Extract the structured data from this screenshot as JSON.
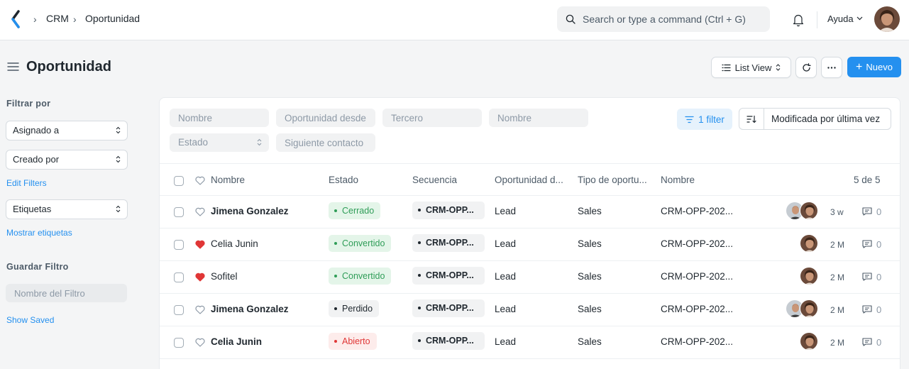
{
  "navbar": {
    "breadcrumbs": [
      "CRM",
      "Oportunidad"
    ],
    "search_placeholder": "Search or type a command (Ctrl + G)",
    "help_label": "Ayuda"
  },
  "header": {
    "title": "Oportunidad",
    "view_label": "List View",
    "new_label": "Nuevo"
  },
  "sidebar": {
    "filter_heading": "Filtrar por",
    "assigned_label": "Asignado a",
    "created_label": "Creado por",
    "edit_filters": "Edit Filters",
    "tags_label": "Etiquetas",
    "show_tags": "Mostrar etiquetas",
    "save_heading": "Guardar Filtro",
    "filter_name_placeholder": "Nombre del Filtro",
    "show_saved": "Show Saved"
  },
  "filters": {
    "nombre_placeholder": "Nombre",
    "desde_placeholder": "Oportunidad desde",
    "tercero_placeholder": "Tercero",
    "nombre2_placeholder": "Nombre",
    "estado_label": "Estado",
    "contacto_placeholder": "Siguiente contacto",
    "filter_count_label": "1 filter",
    "sort_label": "Modificada por última vez"
  },
  "table": {
    "headers": {
      "nombre": "Nombre",
      "estado": "Estado",
      "secuencia": "Secuencia",
      "oportunidad": "Oportunidad d...",
      "tipo": "Tipo de oportu...",
      "nombre2": "Nombre",
      "count": "5 de 5"
    },
    "rows": [
      {
        "name": "Jimena Gonzalez",
        "status": "Cerrado",
        "sequence": "CRM-OPP...",
        "from": "Lead",
        "type": "Sales",
        "ref": "CRM-OPP-202...",
        "time": "3 w",
        "comments": "0"
      },
      {
        "name": "Celia Junin",
        "status": "Convertido",
        "sequence": "CRM-OPP...",
        "from": "Lead",
        "type": "Sales",
        "ref": "CRM-OPP-202...",
        "time": "2 M",
        "comments": "0"
      },
      {
        "name": "Sofitel",
        "status": "Convertido",
        "sequence": "CRM-OPP...",
        "from": "Lead",
        "type": "Sales",
        "ref": "CRM-OPP-202...",
        "time": "2 M",
        "comments": "0"
      },
      {
        "name": "Jimena Gonzalez",
        "status": "Perdido",
        "sequence": "CRM-OPP...",
        "from": "Lead",
        "type": "Sales",
        "ref": "CRM-OPP-202...",
        "time": "2 M",
        "comments": "0"
      },
      {
        "name": "Celia Junin",
        "status": "Abierto",
        "sequence": "CRM-OPP...",
        "from": "Lead",
        "type": "Sales",
        "ref": "CRM-OPP-202...",
        "time": "2 M",
        "comments": "0"
      }
    ]
  },
  "colors": {
    "accent": "#2490ef",
    "liked": "#e03636",
    "status_green": "#2f9d58",
    "status_red": "#e03636"
  },
  "icons": [
    "frappe-logo-icon",
    "search-icon",
    "bell-icon",
    "chevron-down-icon",
    "menu-icon",
    "list-icon",
    "refresh-icon",
    "more-icon",
    "plus-icon",
    "filter-icon",
    "sort-direction-icon",
    "heart-icon",
    "comment-icon"
  ]
}
